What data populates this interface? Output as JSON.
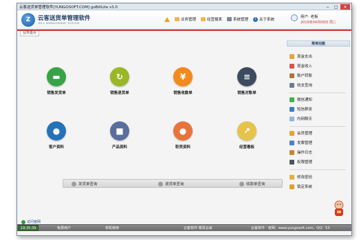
{
  "window": {
    "title": "云客送货单管理软件[YUNGOSOFT.COM]   goBillLite v3.0",
    "buttons": {
      "minimize": "−",
      "maximize": "□",
      "close": "✕"
    }
  },
  "header": {
    "logo_text": "Z",
    "app_name": "云客送货单管理软件",
    "app_subtitle": "BILL  MANAGEMENT  SYSTEM",
    "menu": [
      {
        "label": "业务管理",
        "icon": "folder-icon"
      },
      {
        "label": "经营报表",
        "icon": "folder-icon"
      },
      {
        "label": "系统管理",
        "icon": "document-icon"
      },
      {
        "label": "关于系统",
        "icon": "info-icon"
      }
    ],
    "user_label": "用户: 老板",
    "date_text": "2019年04月09日 周二"
  },
  "tab": {
    "label": "业务首页"
  },
  "tiles": [
    {
      "label": "销售发货单",
      "icon": "delivery-truck-icon",
      "color": "#38a346",
      "glyph": "▬"
    },
    {
      "label": "销售退货单",
      "icon": "return-arrow-icon",
      "color": "#9ab826",
      "glyph": "↻"
    },
    {
      "label": "销售收款单",
      "icon": "yuan-coin-icon",
      "color": "#f28a1e",
      "glyph": "¥"
    },
    {
      "label": "销售对账单",
      "icon": "clipboard-icon",
      "color": "#3c4b5e",
      "glyph": "≡"
    },
    {
      "label": "客户资料",
      "icon": "customer-icon",
      "color": "#2473b8",
      "glyph": "●"
    },
    {
      "label": "产品资料",
      "icon": "product-boxes-icon",
      "color": "#5a6e9e",
      "glyph": "■"
    },
    {
      "label": "职员资料",
      "icon": "employee-icon",
      "color": "#e8743b",
      "glyph": "●"
    },
    {
      "label": "经营看板",
      "icon": "dashboard-chart-icon",
      "color": "#e6c34a",
      "glyph": "↗"
    }
  ],
  "action_bar": [
    {
      "label": "发货单查询"
    },
    {
      "label": "退货单查询"
    },
    {
      "label": "收款单查询"
    }
  ],
  "visit_link": "访问官网",
  "right_panel": {
    "header": "常用功能",
    "items": [
      {
        "label": "现金支出",
        "icon": "cash-out-icon",
        "color": "#e9a23b"
      },
      {
        "label": "现金收入",
        "icon": "cash-in-icon",
        "color": "#d9534f"
      },
      {
        "label": "账户转账",
        "icon": "transfer-icon",
        "color": "#b0713a"
      },
      {
        "label": "收支查询",
        "icon": "search-records-icon",
        "color": "#6d7c8c"
      },
      {
        "label": "微信通知",
        "icon": "wechat-icon",
        "color": "#3bb54a"
      },
      {
        "label": "短信群发",
        "icon": "sms-icon",
        "color": "#3a7fc1"
      },
      {
        "label": "内网聊天",
        "icon": "chat-icon",
        "color": "#8fb8e0"
      },
      {
        "label": "会员管理",
        "icon": "member-icon",
        "color": "#e4a42c"
      },
      {
        "label": "发票管理",
        "icon": "invoice-icon",
        "color": "#4f7ec4"
      },
      {
        "label": "操作日志",
        "icon": "log-icon",
        "color": "#c8832f"
      },
      {
        "label": "权限管理",
        "icon": "permission-icon",
        "color": "#4a5563"
      },
      {
        "label": "修改密码",
        "icon": "key-icon",
        "color": "#e3b23c"
      },
      {
        "label": "锁定系统",
        "icon": "lock-icon",
        "color": "#e0a030"
      }
    ]
  },
  "status_bar": {
    "time": "19:35:39",
    "left_text": "免费用户",
    "mode_text": "单机使用",
    "vendor_text": "云客软件·尊贵云来",
    "site_text": "云客软件 · 官网：www.yungosoft.com，QQ：53"
  }
}
